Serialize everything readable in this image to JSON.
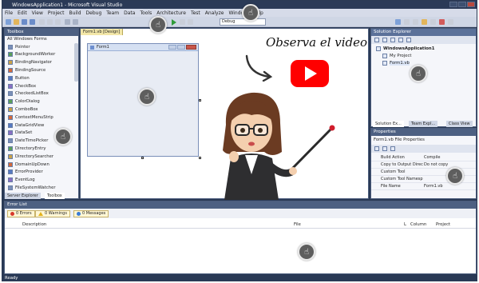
{
  "window_title": "WindowsApplication1 - Microsoft Visual Studio",
  "menu": [
    "File",
    "Edit",
    "View",
    "Project",
    "Build",
    "Debug",
    "Team",
    "Data",
    "Tools",
    "Architecture",
    "Test",
    "Analyze",
    "Window",
    "Help"
  ],
  "toolbar": {
    "config": "Debug"
  },
  "toolbox": {
    "title": "Toolbox",
    "group": "All Windows Forms",
    "items": [
      "Pointer",
      "BackgroundWorker",
      "BindingNavigator",
      "BindingSource",
      "Button",
      "CheckBox",
      "CheckedListBox",
      "ColorDialog",
      "ComboBox",
      "ContextMenuStrip",
      "DataGridView",
      "DataSet",
      "DateTimePicker",
      "DirectoryEntry",
      "DirectorySearcher",
      "DomainUpDown",
      "ErrorProvider",
      "EventLog",
      "FileSystemWatcher"
    ],
    "tabs": [
      "Server Explorer",
      "Toolbox"
    ]
  },
  "designer": {
    "tab": "Form1.vb [Design]",
    "form_title": "Form1"
  },
  "overlay": {
    "text": "Observa el video"
  },
  "solution_explorer": {
    "title": "Solution Explorer",
    "tree": [
      "WindowsApplication1",
      "My Project",
      "Form1.vb"
    ],
    "tabs": [
      "Solution Ex...",
      "Team Expl...",
      "Class View"
    ]
  },
  "properties": {
    "title": "Properties",
    "subject": "Form1.vb File Properties",
    "rows": [
      [
        "Build Action",
        "Compile"
      ],
      [
        "Copy to Output Direc",
        "Do not copy"
      ],
      [
        "Custom Tool",
        ""
      ],
      [
        "Custom Tool Namesp",
        ""
      ],
      [
        "File Name",
        "Form1.vb"
      ]
    ]
  },
  "error_list": {
    "title": "Error List",
    "errors": "0 Errors",
    "warnings": "0 Warnings",
    "messages": "0 Messages",
    "columns": [
      "Description",
      "File",
      "L",
      "Column",
      "Project"
    ]
  },
  "status": "Ready",
  "colors": {
    "chrome": "#293955",
    "youtube": "#ff0000"
  }
}
